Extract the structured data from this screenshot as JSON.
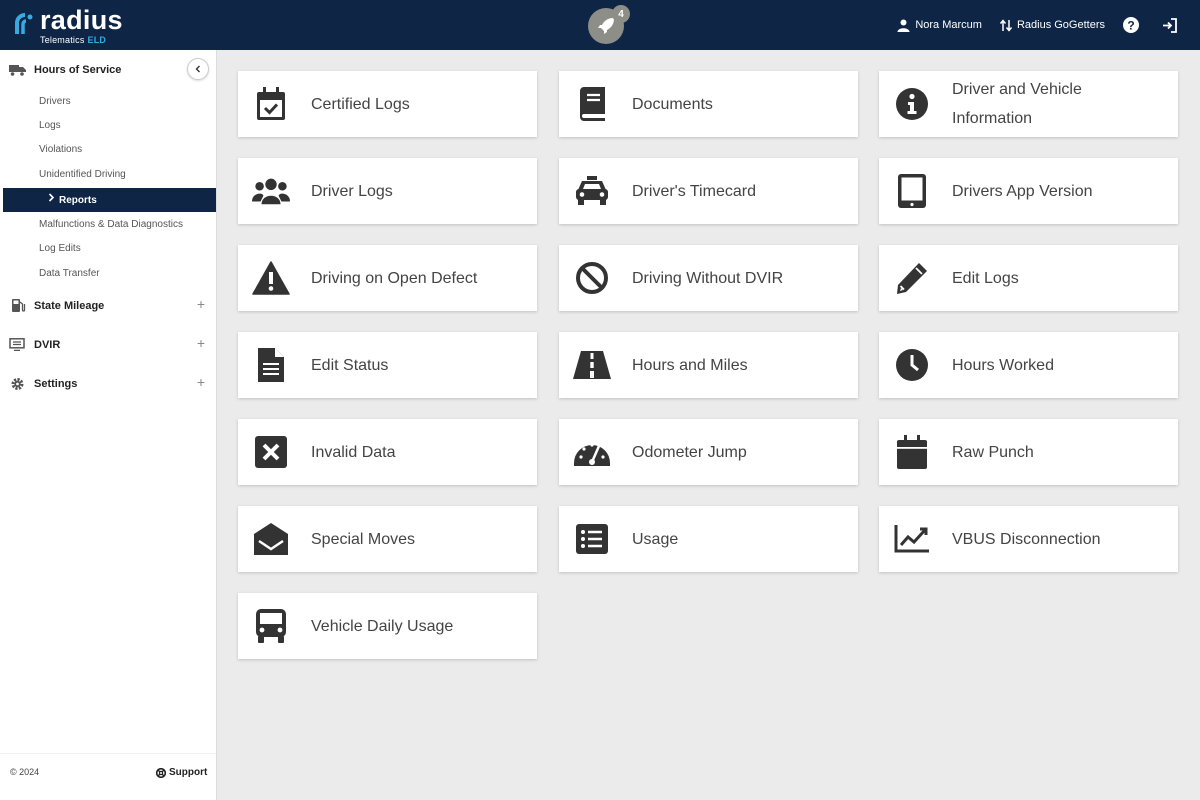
{
  "brand": {
    "name": "radius",
    "subtitle": "Telematics",
    "subtitle_accent": "ELD",
    "accent_color": "#39a9e0",
    "header_color": "#0f2545"
  },
  "header": {
    "notification_count": "4",
    "user_name": "Nora Marcum",
    "org_name": "Radius GoGetters"
  },
  "sidebar": {
    "sections": [
      {
        "label": "Hours of Service",
        "icon": "truck-icon"
      },
      {
        "label": "State Mileage",
        "icon": "fuel-icon"
      },
      {
        "label": "DVIR",
        "icon": "monitor-icon"
      },
      {
        "label": "Settings",
        "icon": "gear-icon"
      }
    ],
    "hos_items": [
      "Drivers",
      "Logs",
      "Violations",
      "Unidentified Driving",
      "Reports",
      "Malfunctions & Data Diagnostics",
      "Log Edits",
      "Data Transfer"
    ],
    "active_item": "Reports",
    "plus": "+",
    "footer": {
      "copyright": "© 2024",
      "support": "Support"
    }
  },
  "reports": [
    {
      "label": "Certified Logs",
      "icon": "calendar-check-icon"
    },
    {
      "label": "Documents",
      "icon": "book-icon"
    },
    {
      "label": "Driver and Vehicle Information",
      "icon": "info-circle-icon"
    },
    {
      "label": "Driver Logs",
      "icon": "users-icon"
    },
    {
      "label": "Driver's Timecard",
      "icon": "taxi-icon"
    },
    {
      "label": "Drivers App Version",
      "icon": "tablet-icon"
    },
    {
      "label": "Driving on Open Defect",
      "icon": "warning-icon"
    },
    {
      "label": "Driving Without DVIR",
      "icon": "ban-icon"
    },
    {
      "label": "Edit Logs",
      "icon": "pencil-icon"
    },
    {
      "label": "Edit Status",
      "icon": "file-text-icon"
    },
    {
      "label": "Hours and Miles",
      "icon": "road-icon"
    },
    {
      "label": "Hours Worked",
      "icon": "clock-icon"
    },
    {
      "label": "Invalid Data",
      "icon": "x-square-icon"
    },
    {
      "label": "Odometer Jump",
      "icon": "speedometer-icon"
    },
    {
      "label": "Raw Punch",
      "icon": "calendar-icon"
    },
    {
      "label": "Special Moves",
      "icon": "envelope-open-icon"
    },
    {
      "label": "Usage",
      "icon": "list-icon"
    },
    {
      "label": "VBUS Disconnection",
      "icon": "line-chart-icon"
    },
    {
      "label": "Vehicle Daily Usage",
      "icon": "bus-icon"
    }
  ]
}
